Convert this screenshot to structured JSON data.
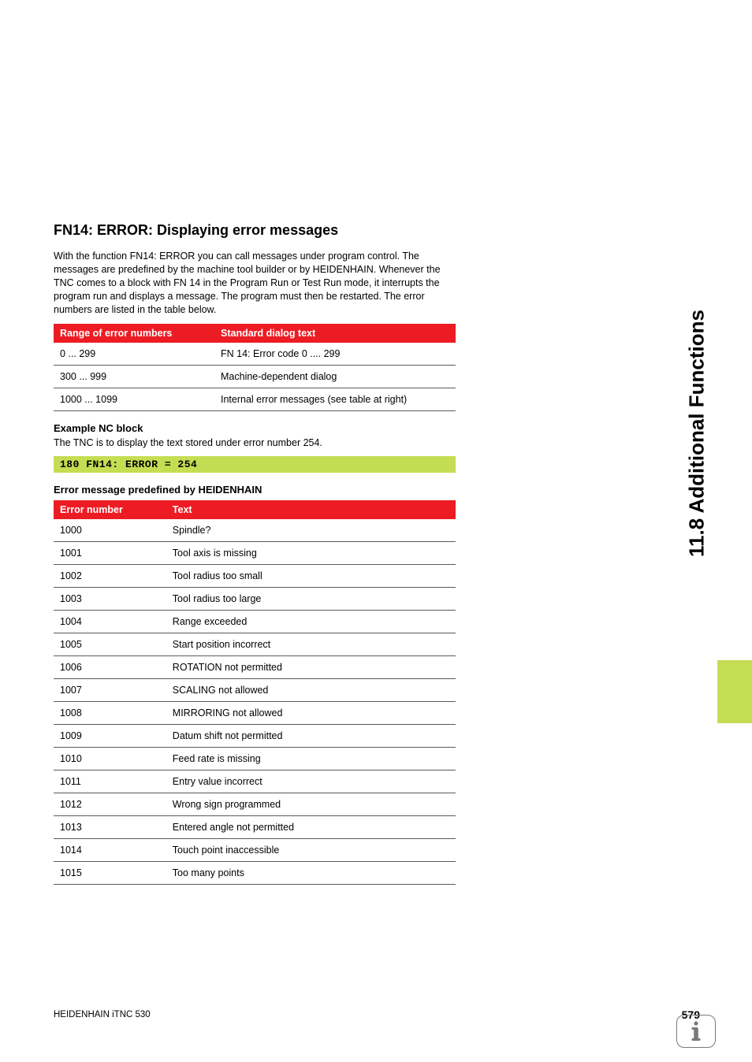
{
  "sideTab": "11.8 Additional Functions",
  "section": {
    "title": "FN14: ERROR: Displaying error messages",
    "intro": "With the function FN14: ERROR you can call messages under program control. The messages are predefined by the machine tool builder or by HEIDENHAIN. Whenever the TNC comes to a block with FN 14 in the Program Run or Test Run mode, it interrupts the program run and displays a message. The program must then be restarted. The error numbers are listed in the table below."
  },
  "table1": {
    "headers": [
      "Range of error numbers",
      "Standard dialog text"
    ],
    "rows": [
      [
        "0 ... 299",
        "FN 14: Error code 0 .... 299"
      ],
      [
        "300 ... 999",
        "Machine-dependent dialog"
      ],
      [
        "1000 ... 1099",
        "Internal error messages (see table at right)"
      ]
    ]
  },
  "example": {
    "heading": "Example NC block",
    "text": "The TNC is to display the text stored under error number 254.",
    "code": "180 FN14: ERROR = 254"
  },
  "table2": {
    "heading": "Error message predefined by HEIDENHAIN",
    "headers": [
      "Error number",
      "Text"
    ],
    "rows": [
      [
        "1000",
        "Spindle?"
      ],
      [
        "1001",
        "Tool axis is missing"
      ],
      [
        "1002",
        "Tool radius too small"
      ],
      [
        "1003",
        "Tool radius too large"
      ],
      [
        "1004",
        "Range exceeded"
      ],
      [
        "1005",
        "Start position incorrect"
      ],
      [
        "1006",
        "ROTATION not permitted"
      ],
      [
        "1007",
        "SCALING not allowed"
      ],
      [
        "1008",
        "MIRRORING not allowed"
      ],
      [
        "1009",
        "Datum shift not permitted"
      ],
      [
        "1010",
        "Feed rate is missing"
      ],
      [
        "1011",
        "Entry value incorrect"
      ],
      [
        "1012",
        "Wrong sign programmed"
      ],
      [
        "1013",
        "Entered angle not permitted"
      ],
      [
        "1014",
        "Touch point inaccessible"
      ],
      [
        "1015",
        "Too many points"
      ]
    ]
  },
  "footer": {
    "left": "HEIDENHAIN iTNC 530",
    "page": "579"
  }
}
